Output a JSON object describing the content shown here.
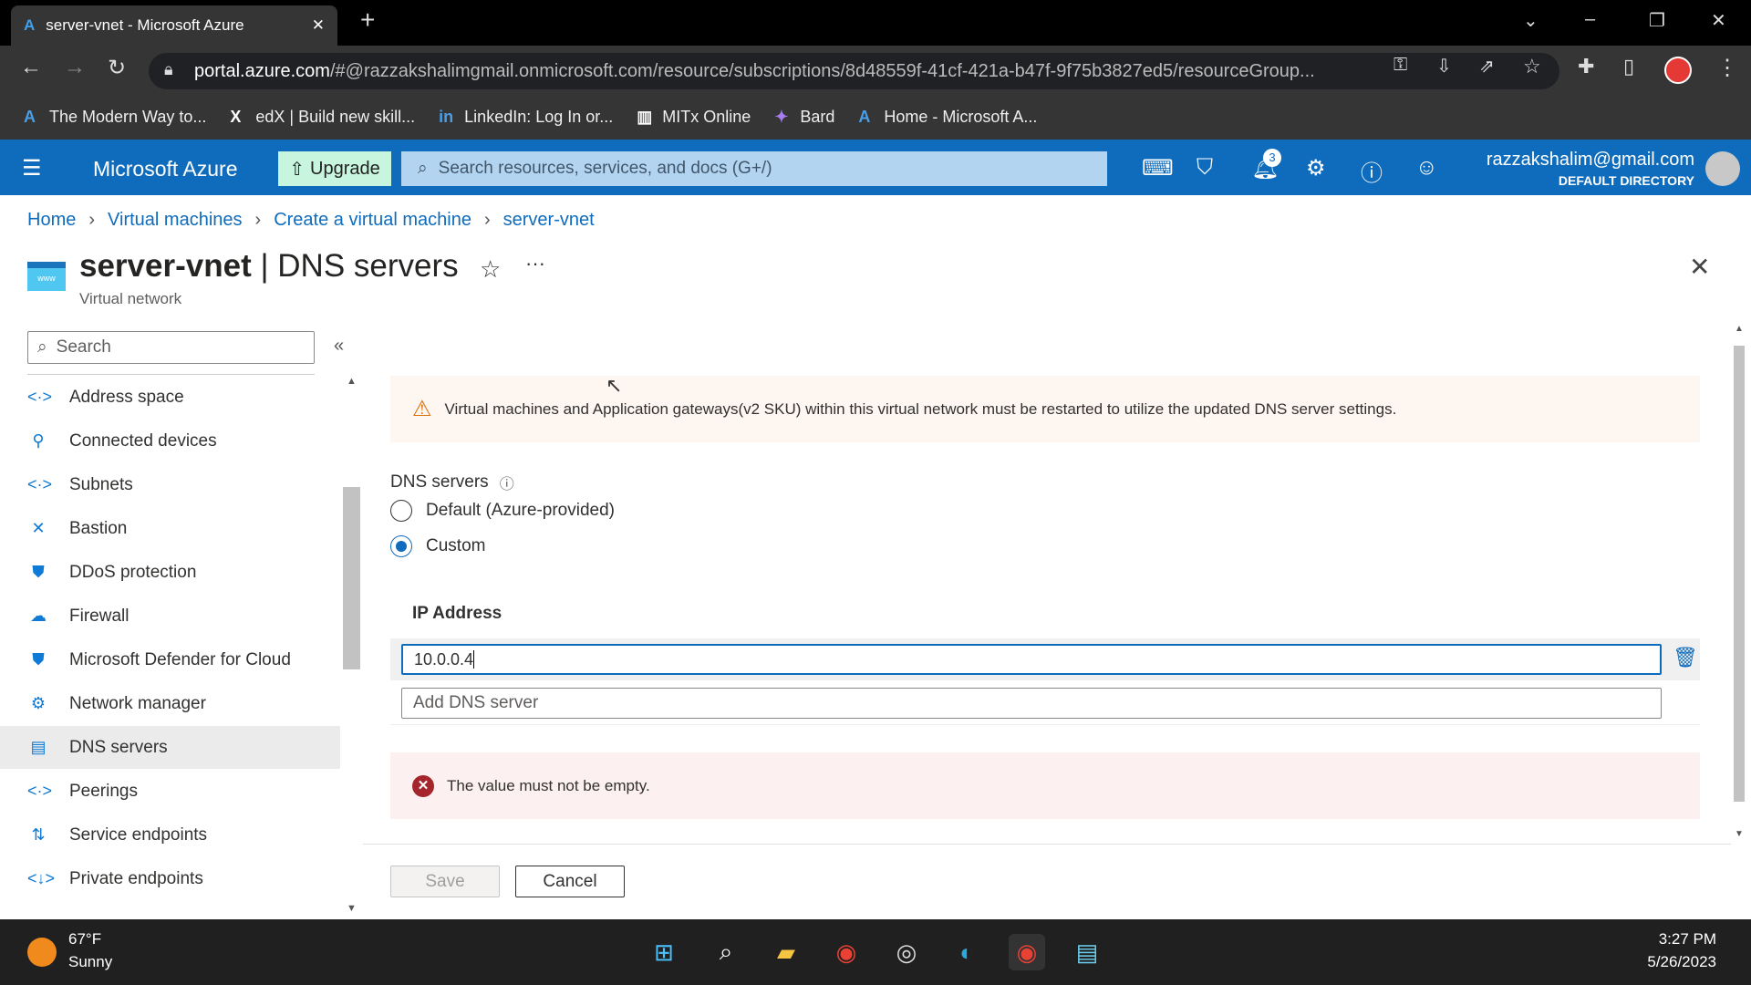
{
  "browser": {
    "tab_title": "server-vnet - Microsoft Azure",
    "url_host": "portal.azure.com",
    "url_rest": "/#@razzakshalimgmail.onmicrosoft.com/resource/subscriptions/8d48559f-41cf-421a-b47f-9f75b3827ed5/resourceGroup...",
    "bookmarks": [
      "The Modern Way to...",
      "edX | Build new skill...",
      "LinkedIn: Log In or...",
      "MITx Online",
      "Bard",
      "Home - Microsoft A..."
    ]
  },
  "azure": {
    "brand": "Microsoft Azure",
    "upgrade": "Upgrade",
    "search_placeholder": "Search resources, services, and docs (G+/)",
    "notification_count": "3",
    "user_email": "razzakshalim@gmail.com",
    "directory": "DEFAULT DIRECTORY",
    "accent": "#0f6cbd"
  },
  "breadcrumb": [
    "Home",
    "Virtual machines",
    "Create a virtual machine",
    "server-vnet"
  ],
  "page": {
    "resource": "server-vnet",
    "section": "DNS servers",
    "subtitle": "Virtual network"
  },
  "sidebar": {
    "search_placeholder": "Search",
    "items": [
      {
        "label": "Address space",
        "icon": "<·>"
      },
      {
        "label": "Connected devices",
        "icon": "⚲"
      },
      {
        "label": "Subnets",
        "icon": "<·>"
      },
      {
        "label": "Bastion",
        "icon": "✕"
      },
      {
        "label": "DDoS protection",
        "icon": "⛊"
      },
      {
        "label": "Firewall",
        "icon": "☁"
      },
      {
        "label": "Microsoft Defender for Cloud",
        "icon": "⛊"
      },
      {
        "label": "Network manager",
        "icon": "⚙"
      },
      {
        "label": "DNS servers",
        "icon": "▤",
        "selected": true
      },
      {
        "label": "Peerings",
        "icon": "<·>"
      },
      {
        "label": "Service endpoints",
        "icon": "⇅"
      },
      {
        "label": "Private endpoints",
        "icon": "<↓>"
      }
    ]
  },
  "main": {
    "warning": "Virtual machines and Application gateways(v2 SKU) within this virtual network must be restarted to utilize the updated DNS server settings.",
    "dns_label": "DNS servers",
    "options": [
      {
        "label": "Default (Azure-provided)",
        "selected": false
      },
      {
        "label": "Custom",
        "selected": true
      }
    ],
    "ip_header": "IP Address",
    "ip_value": "10.0.0.4",
    "add_placeholder": "Add DNS server",
    "error": "The value must not be empty.",
    "save": "Save",
    "cancel": "Cancel"
  },
  "taskbar": {
    "temp": "67°F",
    "weather": "Sunny",
    "time": "3:27 PM",
    "date": "5/26/2023"
  }
}
